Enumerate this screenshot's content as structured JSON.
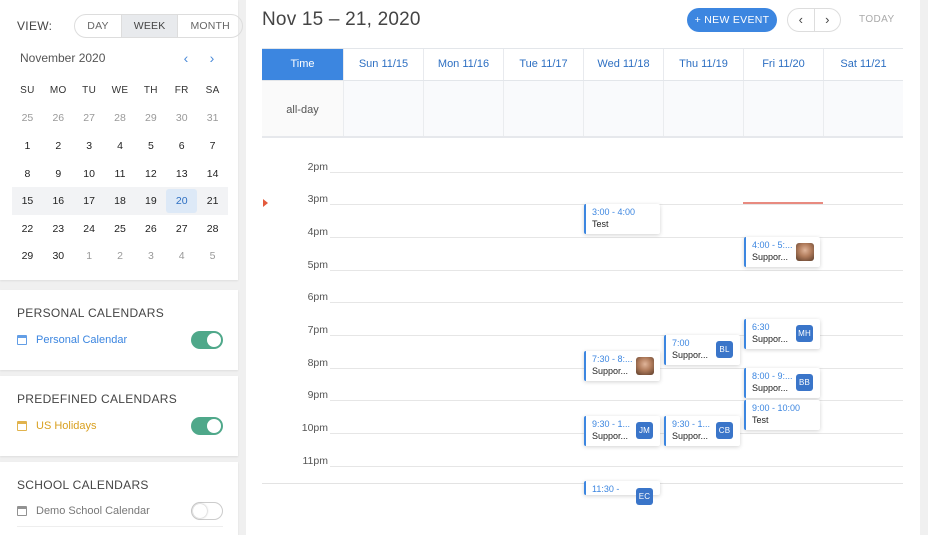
{
  "sidebar": {
    "view": {
      "label": "VIEW:",
      "options": [
        "DAY",
        "WEEK",
        "MONTH"
      ],
      "active": "WEEK"
    },
    "mini_calendar": {
      "month_title": "November 2020",
      "prev_icon": "chevron-left-icon",
      "next_icon": "chevron-right-icon",
      "weekday_headers": [
        "SU",
        "MO",
        "TU",
        "WE",
        "TH",
        "FR",
        "SA"
      ],
      "weeks": [
        [
          "25",
          "26",
          "27",
          "28",
          "29",
          "30",
          "31"
        ],
        [
          "1",
          "2",
          "3",
          "4",
          "5",
          "6",
          "7"
        ],
        [
          "8",
          "9",
          "10",
          "11",
          "12",
          "13",
          "14"
        ],
        [
          "15",
          "16",
          "17",
          "18",
          "19",
          "20",
          "21"
        ],
        [
          "22",
          "23",
          "24",
          "25",
          "26",
          "27",
          "28"
        ],
        [
          "29",
          "30",
          "1",
          "2",
          "3",
          "4",
          "5"
        ]
      ],
      "selected_day": "20"
    },
    "personal": {
      "title": "PERSONAL CALENDARS",
      "items": [
        {
          "name": "Personal Calendar",
          "color": "#3c86e0",
          "enabled": true
        }
      ]
    },
    "predefined": {
      "title": "PREDEFINED CALENDARS",
      "items": [
        {
          "name": "US Holidays",
          "color": "#d9a020",
          "enabled": true
        }
      ]
    },
    "school": {
      "title": "SCHOOL CALENDARS",
      "items": [
        {
          "name": "Demo School Calendar",
          "color": "#777777",
          "enabled": false
        }
      ]
    }
  },
  "header": {
    "week_title": "Nov 15 – 21, 2020",
    "new_event_label": "+ NEW EVENT",
    "prev_icon": "chevron-left-icon",
    "next_icon": "chevron-right-icon",
    "today_label": "TODAY"
  },
  "grid": {
    "time_header": "Time",
    "days": [
      "Sun 11/15",
      "Mon 11/16",
      "Tue 11/17",
      "Wed 11/18",
      "Thu 11/19",
      "Fri 11/20",
      "Sat 11/21"
    ],
    "allday_label": "all-day",
    "hours": [
      "2pm",
      "3pm",
      "4pm",
      "5pm",
      "6pm",
      "7pm",
      "8pm",
      "9pm",
      "10pm",
      "11pm"
    ]
  },
  "events": [
    {
      "day": "Wed 11/18",
      "time": "3:00 - 4:00",
      "title": "Test"
    },
    {
      "day": "Fri 11/20",
      "time": "4:00 - 5:...",
      "title": "Suppor...",
      "avatar": true
    },
    {
      "day": "Fri 11/20",
      "time": "6:30",
      "title": "Suppor...",
      "badge": "MH"
    },
    {
      "day": "Thu 11/19",
      "time": "7:00",
      "title": "Suppor...",
      "badge": "BL"
    },
    {
      "day": "Wed 11/18",
      "time": "7:30 - 8:...",
      "title": "Suppor...",
      "avatar": true
    },
    {
      "day": "Fri 11/20",
      "time": "8:00 - 9:...",
      "title": "Suppor...",
      "badge": "BB"
    },
    {
      "day": "Fri 11/20",
      "time": "9:00 - 10:00",
      "title": "Test"
    },
    {
      "day": "Wed 11/18",
      "time": "9:30 - 1...",
      "title": "Suppor...",
      "badge": "JM"
    },
    {
      "day": "Thu 11/19",
      "time": "9:30 - 1...",
      "title": "Suppor...",
      "badge": "CB"
    },
    {
      "day": "Wed 11/18",
      "time": "11:30 -",
      "title": "",
      "badge": "EC"
    }
  ]
}
